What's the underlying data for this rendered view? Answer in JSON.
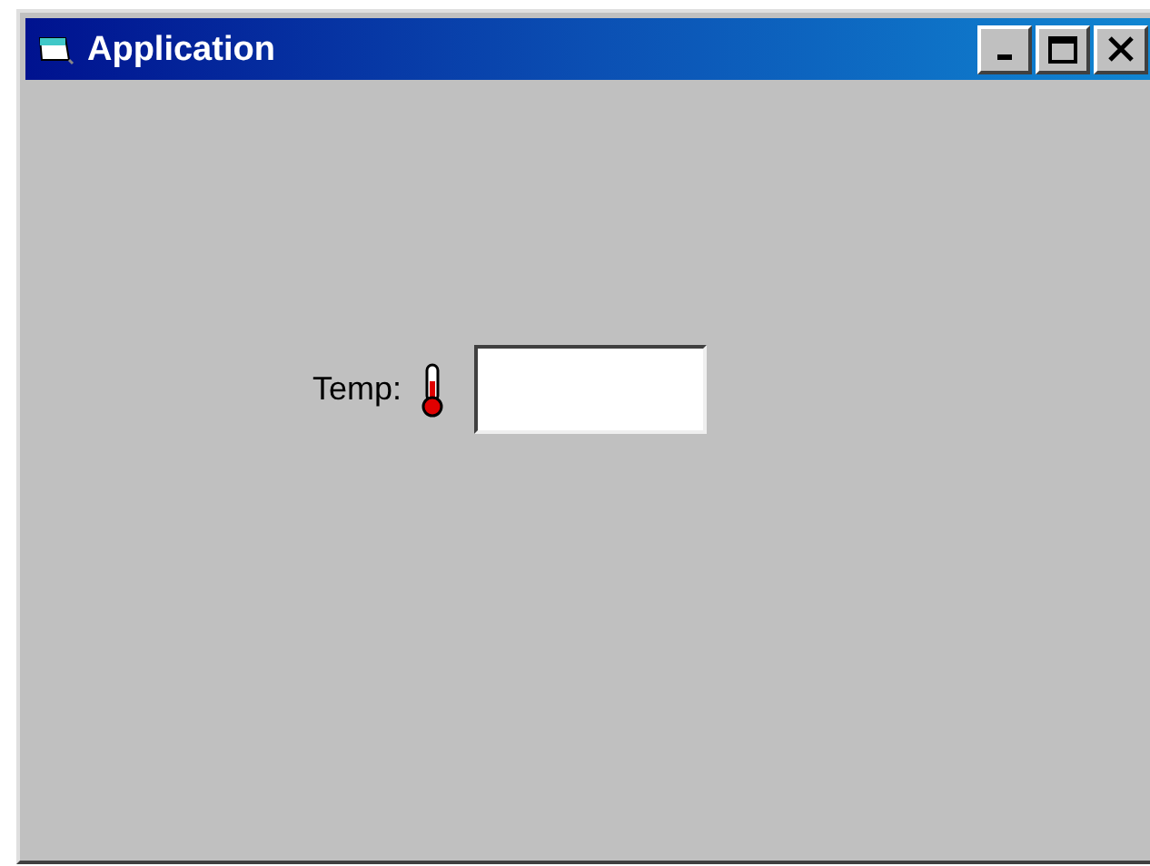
{
  "window": {
    "title": "Application"
  },
  "form": {
    "label": "Temp:"
  }
}
